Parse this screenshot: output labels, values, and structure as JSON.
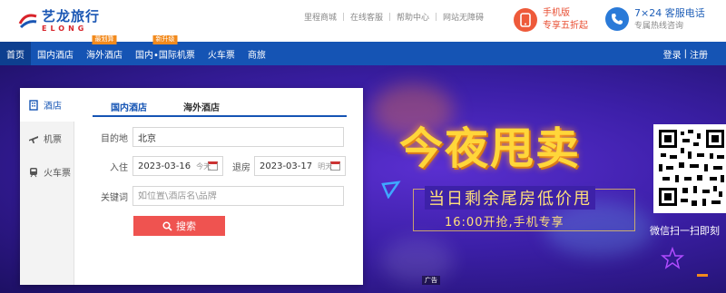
{
  "header": {
    "logo_cn": "艺龙旅行",
    "logo_en": "ELONG",
    "top_links": [
      "里程商城",
      "在线客服",
      "帮助中心",
      "网站无障碍"
    ],
    "mobile_promo": {
      "title": "手机版",
      "subtitle": "专享五折起",
      "icon": "phone-icon"
    },
    "phone_promo": {
      "title": "7×24 客服电话",
      "subtitle": "专属热线咨询",
      "icon": "phone-call-icon"
    }
  },
  "nav": {
    "items": [
      {
        "label": "首页",
        "badge": ""
      },
      {
        "label": "国内酒店",
        "badge": ""
      },
      {
        "label": "海外酒店",
        "badge": "最划算"
      },
      {
        "label": "国内•国际机票",
        "badge": "新升级"
      },
      {
        "label": "火车票",
        "badge": ""
      },
      {
        "label": "商旅",
        "badge": ""
      }
    ],
    "login": "登录",
    "register": "注册",
    "login_sep": "|"
  },
  "panel": {
    "side_tabs": [
      {
        "label": "酒店",
        "icon": "hotel-icon"
      },
      {
        "label": "机票",
        "icon": "plane-icon"
      },
      {
        "label": "火车票",
        "icon": "train-icon"
      }
    ],
    "sub_tabs": [
      "国内酒店",
      "海外酒店"
    ],
    "destination": {
      "label": "目的地",
      "value": "北京"
    },
    "checkin": {
      "label": "入住",
      "value": "2023-03-16",
      "hint": "今天"
    },
    "checkout": {
      "label": "退房",
      "value": "2023-03-17",
      "hint": "明天"
    },
    "keyword": {
      "label": "关键词",
      "placeholder": "如位置\\酒店名\\品牌"
    },
    "search_label": "搜索"
  },
  "banner": {
    "headline": "今夜甩卖",
    "subline1": "当日剩余尾房低价甩",
    "subline2": "16:00开抢,手机专享",
    "qr_label": "微信扫一扫即刻",
    "ad_tag": "广告"
  },
  "colors": {
    "brand_blue": "#1554b4",
    "brand_red": "#d8232a",
    "search_button": "#ef5350",
    "headline_yellow": "#ffd63a"
  }
}
